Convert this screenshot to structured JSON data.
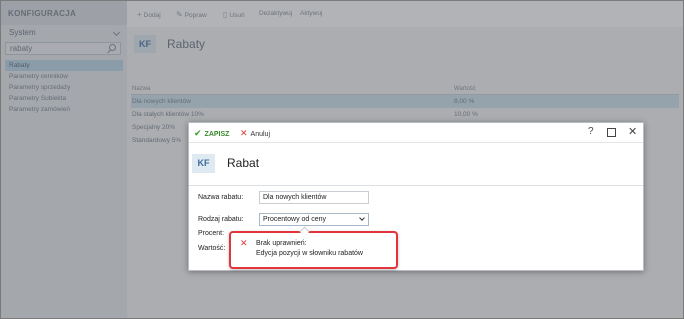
{
  "sidebar": {
    "header": "KONFIGURACJA",
    "selector_value": "System",
    "search_value": "rabaty",
    "items": [
      {
        "label": "Rabaty",
        "active": true
      },
      {
        "label": "Parametry cenników",
        "active": false
      },
      {
        "label": "Parametry sprzedaży",
        "active": false
      },
      {
        "label": "Parametry Subiekta",
        "active": false
      },
      {
        "label": "Parametry zamówień",
        "active": false
      }
    ]
  },
  "toolbar": {
    "add_label": "Dodaj",
    "edit_label": "Popraw",
    "delete_label": "Usuń",
    "deactivate_label": "Dezaktywuj",
    "activate_label": "Aktywuj"
  },
  "page": {
    "badge": "KF",
    "title": "Rabaty"
  },
  "grid": {
    "columns": [
      "Nazwa",
      "Wartość"
    ],
    "rows": [
      {
        "name": "Dla nowych klientów",
        "value": "8,00 %",
        "selected": true
      },
      {
        "name": "Dla stałych klientów 10%",
        "value": "10,00 %",
        "selected": false
      },
      {
        "name": "Specjalny 20%",
        "value": "",
        "selected": false
      },
      {
        "name": "Standardowy 5%",
        "value": "",
        "selected": false
      }
    ]
  },
  "modal": {
    "save_label": "ZAPISZ",
    "cancel_label": "Anuluj",
    "help_label": "?",
    "badge": "KF",
    "title": "Rabat",
    "form": {
      "name_label": "Nazwa rabatu:",
      "name_value": "Dla nowych klientów",
      "type_label": "Rodzaj rabatu:",
      "type_value": "Procentowy od ceny",
      "percent_label": "Procent:",
      "value_label": "Wartość:"
    }
  },
  "error": {
    "title": "Brak uprawnień:",
    "message": "Edycja pozycji w słowniku rabatów"
  },
  "colors": {
    "accent": "#4d7aa5",
    "save_green": "#3a9b2a",
    "error_red": "#e2353b",
    "selected_row": "#cfe3f0"
  },
  "icons": {
    "save": "check-icon",
    "cancel": "cross-icon",
    "help": "question-icon",
    "maximize": "maximize-icon",
    "close": "close-icon",
    "error": "error-cross-icon",
    "search": "search-icon"
  }
}
